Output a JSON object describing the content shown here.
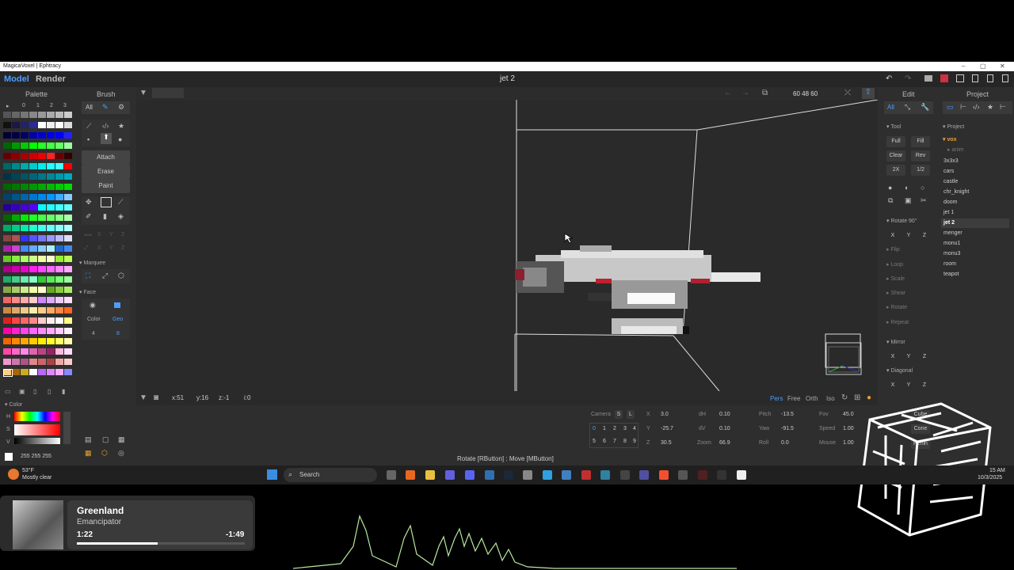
{
  "window": {
    "title": "MagicaVoxel | Ephtracy"
  },
  "menu": {
    "model": "Model",
    "render": "Render",
    "file_title": "jet 2"
  },
  "headers": {
    "palette": "Palette",
    "brush": "Brush",
    "edit": "Edit",
    "project": "Project"
  },
  "palette": {
    "tabs": [
      "0",
      "1",
      "2",
      "3"
    ]
  },
  "brush": {
    "all": "All",
    "attach": "Attach",
    "erase": "Erase",
    "paint": "Paint",
    "marquee": "Marquee",
    "face": "Face",
    "color": "Color",
    "geo": "Geo",
    "color_count": "4",
    "geo_count": "8"
  },
  "viewport": {
    "dims": "60  48  60"
  },
  "status": {
    "x": "x:51",
    "y": "y:16",
    "z": "z:-1",
    "i": "i:0",
    "pers": "Pers",
    "free": "Free",
    "orth": "Orth",
    "iso": "Iso",
    "hint": "Rotate [RButton] : Move [MButton]"
  },
  "color": {
    "title": "Color",
    "h": "H",
    "s": "S",
    "v": "V",
    "rgb": "255  255  255"
  },
  "camera": {
    "label": "Camera",
    "s": "S",
    "l": "L",
    "nums": [
      "0",
      "1",
      "2",
      "3",
      "4",
      "5",
      "6",
      "7",
      "8",
      "9"
    ],
    "x_label": "X",
    "x": "3.0",
    "y_label": "Y",
    "y": "-25.7",
    "z_label": "Z",
    "z": "30.5",
    "dh_label": "dH",
    "dh": "0.10",
    "dv_label": "dV",
    "dv": "0.10",
    "zoom_label": "Zoom",
    "zoom": "66.9",
    "pitch_label": "Pitch",
    "pitch": "-13.5",
    "yaw_label": "Yaw",
    "yaw": "-91.5",
    "roll_label": "Roll",
    "roll": "0.0",
    "fov_label": "Fov",
    "fov": "45.0",
    "speed_label": "Speed",
    "speed": "1.00",
    "mouse_label": "Mouse",
    "mouse": "1.00"
  },
  "edit": {
    "all": "All",
    "tool": "Tool",
    "full": "Full",
    "fill": "Fill",
    "clear": "Clear",
    "rev": "Rev",
    "x2": "2X",
    "half": "1/2",
    "rotate90": "Rotate 90°",
    "flip": "Flip",
    "loop": "Loop",
    "scale": "Scale",
    "shear": "Shear",
    "rotate": "Rotate",
    "repeat": "Repeat",
    "mirror": "Mirror",
    "diagonal": "Diagonal",
    "x": "X",
    "y": "Y",
    "z": "Z",
    "cube": "Cube",
    "cone": "Cone",
    "perlin": "Perlin"
  },
  "project": {
    "section": "Project",
    "folder": "vox",
    "sub": "anim",
    "items": [
      "3x3x3",
      "cars",
      "castle",
      "chr_knight",
      "doom",
      "jet 1",
      "jet 2",
      "menger",
      "monu1",
      "monu3",
      "room",
      "teapot"
    ],
    "selected": "jet 2"
  },
  "taskbar": {
    "temp": "53°F",
    "weather": "Mostly clear",
    "search": "Search",
    "time": "15 AM",
    "date": "10/3/2025"
  },
  "media": {
    "title": "Greenland",
    "artist": "Emancipator",
    "elapsed": "1:22",
    "remaining": "-1:49",
    "progress": 0.48
  },
  "colors": {
    "accent": "#4a9eff",
    "selected_row": "#3d3d3d",
    "vox_folder": "#e8a030"
  }
}
